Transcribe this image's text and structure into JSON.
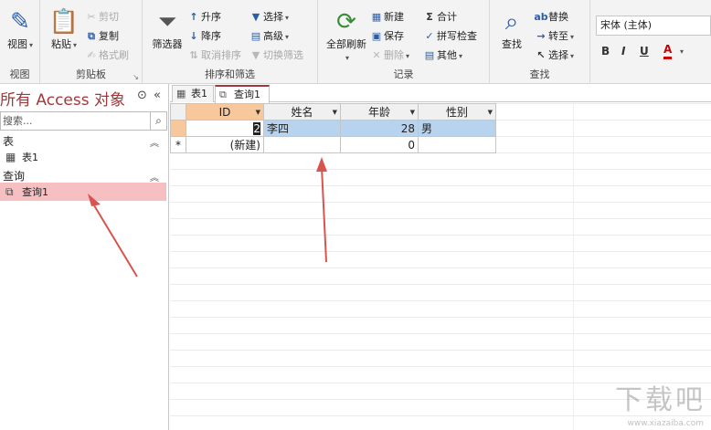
{
  "ribbon": {
    "view": {
      "label": "视图",
      "group": "视图"
    },
    "clipboard": {
      "paste": "粘贴",
      "cut": "剪切",
      "copy": "复制",
      "format_painter": "格式刷",
      "group": "剪贴板"
    },
    "sort_filter": {
      "filter": "筛选器",
      "ascending": "升序",
      "descending": "降序",
      "clear_sort": "取消排序",
      "selection": "选择",
      "advanced": "高级",
      "toggle_filter": "切换筛选",
      "group": "排序和筛选"
    },
    "records": {
      "refresh_all": "全部刷新",
      "new": "新建",
      "save": "保存",
      "delete": "删除",
      "totals": "合计",
      "spelling": "拼写检查",
      "more": "其他",
      "group": "记录"
    },
    "find": {
      "find": "查找",
      "replace": "替换",
      "goto": "转至",
      "select": "选择",
      "group": "查找"
    },
    "text_format": {
      "font": "宋体 (主体)",
      "bold": "B",
      "italic": "I",
      "underline": "U",
      "font_color": "A"
    }
  },
  "nav": {
    "title": "所有 Access 对象",
    "search_placeholder": "搜索...",
    "sections": [
      {
        "label": "表",
        "items": [
          {
            "label": "表1"
          }
        ]
      },
      {
        "label": "查询",
        "items": [
          {
            "label": "查询1",
            "selected": true
          }
        ]
      }
    ]
  },
  "tabs": [
    {
      "label": "表1",
      "active": false
    },
    {
      "label": "查询1",
      "active": true
    }
  ],
  "grid": {
    "columns": [
      "ID",
      "姓名",
      "年龄",
      "性别"
    ],
    "rows": [
      {
        "id": "2",
        "name": "李四",
        "age": "28",
        "gender": "男"
      }
    ],
    "new_row": {
      "id": "(新建)",
      "age": "0",
      "marker": "*"
    }
  },
  "watermark": {
    "text": "下载吧",
    "url": "www.xiazaiba.com"
  },
  "colors": {
    "accent": "#a4373a",
    "selection": "#f6c0c3",
    "row_highlight": "#b8d3ed",
    "arrow": "#d9534f"
  }
}
